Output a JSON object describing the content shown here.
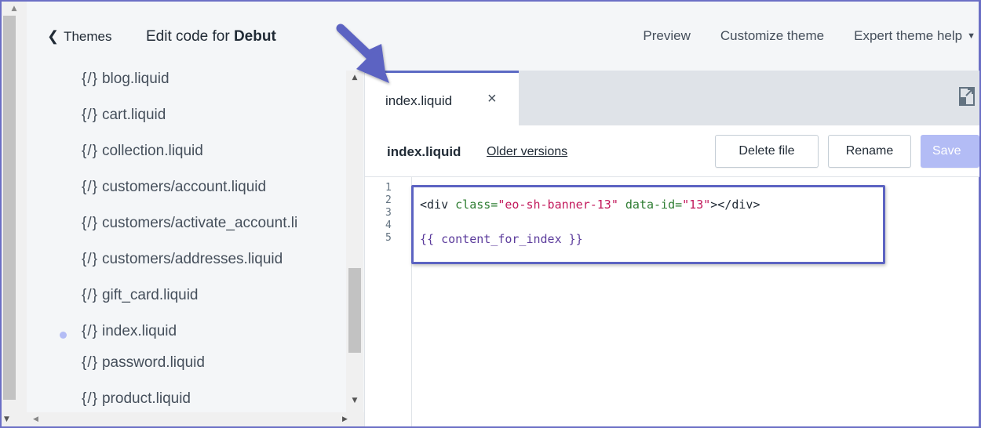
{
  "header": {
    "back_label": "Themes",
    "title_prefix": "Edit code for",
    "theme_name": "Debut",
    "actions": {
      "preview": "Preview",
      "customize": "Customize theme",
      "expert_help": "Expert theme help"
    }
  },
  "sidebar": {
    "icon_glyph": "{/}",
    "files": [
      "blog.liquid",
      "cart.liquid",
      "collection.liquid",
      "customers/account.liquid",
      "customers/activate_account.li",
      "customers/addresses.liquid",
      "gift_card.liquid",
      "index.liquid",
      "password.liquid",
      "product.liquid"
    ],
    "active_file": "index.liquid"
  },
  "editor": {
    "tab_label": "index.liquid",
    "tab_close": "×",
    "file_name": "index.liquid",
    "older_versions": "Older versions",
    "buttons": {
      "delete": "Delete file",
      "rename": "Rename",
      "save": "Save"
    },
    "line_numbers": [
      "1",
      "2",
      "3",
      "4",
      "5"
    ],
    "code": {
      "line2": {
        "open": "<div",
        "attr1": "class=",
        "val1": "\"eo-sh-banner-13\"",
        "attr2": "data-id=",
        "val2": "\"13\"",
        "close": "></div>"
      },
      "line4": "{{ content_for_index }}"
    }
  },
  "colors": {
    "accent": "#5c6ac4",
    "annotation": "#5c63c2",
    "save_disabled": "#b3bcf5",
    "active_dot": "#b3bcf5"
  },
  "icons": [
    "chevron-left-icon",
    "chevron-down-icon",
    "close-icon",
    "expand-icon",
    "liquid-file-icon",
    "annotation-arrow"
  ]
}
